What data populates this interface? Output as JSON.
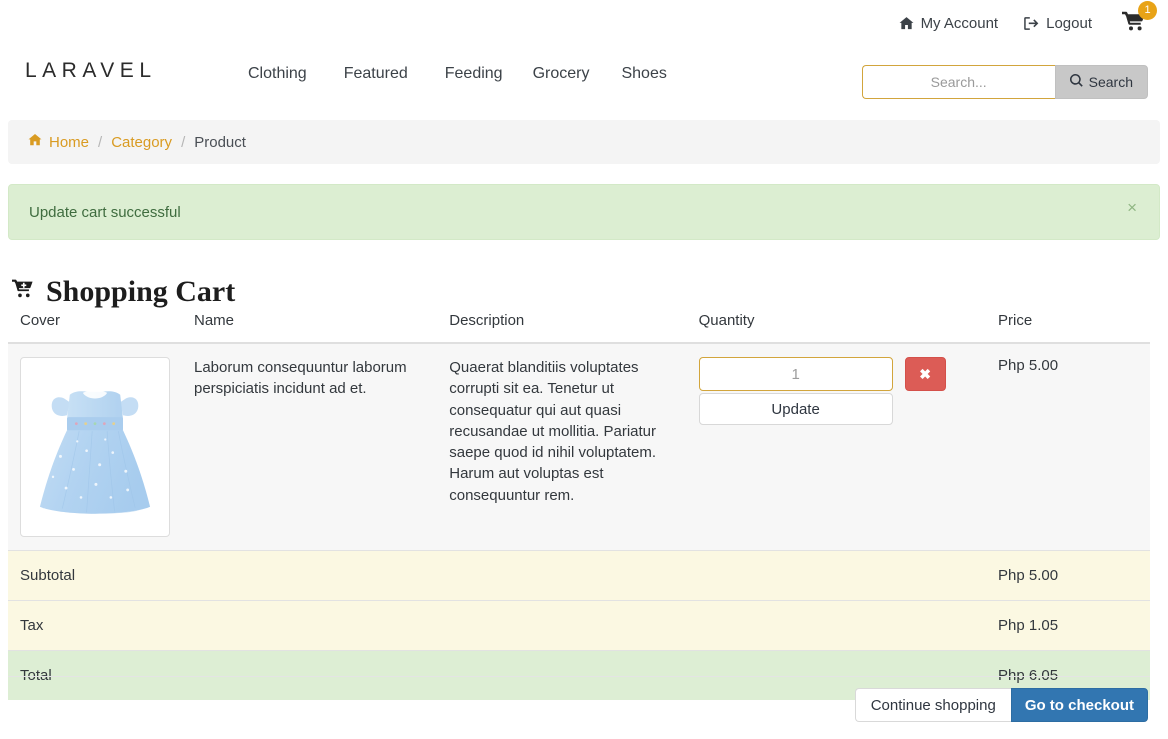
{
  "topbar": {
    "my_account": "My Account",
    "logout": "Logout",
    "cart_badge": "1",
    "icons": {
      "home": "home-icon",
      "logout": "logout-icon",
      "cart": "shopping-cart-icon"
    }
  },
  "header": {
    "brand": "LARAVEL",
    "nav": [
      {
        "label": "Clothing"
      },
      {
        "label": "Featured"
      },
      {
        "label": "Feeding"
      },
      {
        "label": "Grocery"
      },
      {
        "label": "Shoes"
      }
    ],
    "search": {
      "value": "",
      "placeholder": "Search...",
      "button_label": "Search"
    }
  },
  "breadcrumb": {
    "home": "Home",
    "category": "Category",
    "product": "Product",
    "separator": "/"
  },
  "alert": {
    "message": "Update cart successful",
    "close_label": "×",
    "bg_color": "#dceed2",
    "text_color": "#3f6c3f"
  },
  "page": {
    "title": "Shopping Cart"
  },
  "table": {
    "headers": [
      "Cover",
      "Name",
      "Description",
      "Quantity",
      "Price"
    ],
    "rows": [
      {
        "cover_alt": "Light blue floral girls dress",
        "name": "Laborum consequuntur laborum perspiciatis incidunt ad et.",
        "description": "Quaerat blanditiis voluptates corrupti sit ea. Tenetur ut consequatur qui aut quasi recusandae ut mollitia. Pariatur saepe quod id nihil voluptatem. Harum aut voluptas est consequuntur rem.",
        "quantity_value": "",
        "quantity_placeholder": "1",
        "update_label": "Update",
        "delete_label": "✖",
        "price": "Php 5.00"
      }
    ],
    "summary": [
      {
        "label": "Subtotal",
        "value": "Php 5.00",
        "style": "warn"
      },
      {
        "label": "Tax",
        "value": "Php 1.05",
        "style": "warn"
      },
      {
        "label": "Total",
        "value": "Php 6.05",
        "style": "ok"
      }
    ]
  },
  "footer_actions": {
    "continue_label": "Continue shopping",
    "checkout_label": "Go to checkout",
    "checkout_color": "#3276b1"
  }
}
